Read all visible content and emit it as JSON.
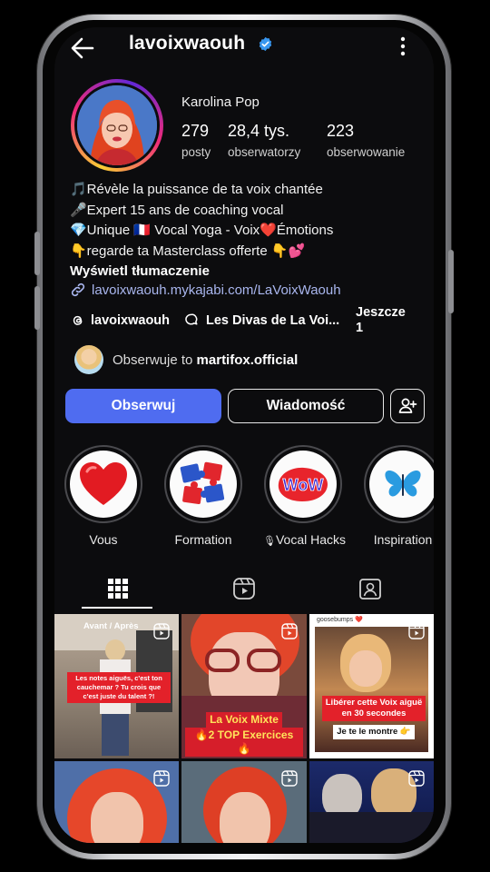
{
  "profile": {
    "username": "lavoixwaouh",
    "display_name": "Karolina Pop",
    "stats": [
      {
        "value": "279",
        "label": "posty"
      },
      {
        "value": "28,4 tys.",
        "label": "obserwatorzy"
      },
      {
        "value": "223",
        "label": "obserwowanie"
      }
    ],
    "bio": [
      "🎵Révèle la puissance de ta voix chantée",
      "🎤Expert 15 ans de coaching vocal",
      "💎Unique 🇫🇷 Vocal Yoga - Voix❤️Émotions",
      "👇regarde ta Masterclass offerte 👇💕"
    ],
    "translate_label": "Wyświetl tłumaczenie",
    "link": "lavoixwaouh.mykajabi.com/LaVoixWaouh",
    "threads_handle": "lavoixwaouh",
    "community_name": "Les Divas de La Voi...",
    "more_label": "Jeszcze",
    "more_count": "1",
    "followed_by_prefix": "Obserwuje to",
    "followed_by_user": "martifox.official"
  },
  "actions": {
    "follow": "Obserwuj",
    "message": "Wiadomość"
  },
  "highlights": [
    {
      "label": "Vous",
      "icon": "heart-icon"
    },
    {
      "label": "Formation",
      "icon": "puzzle-icon"
    },
    {
      "label": "Vocal Hacks",
      "icon": "wow-sticker-icon",
      "prefix_emoji": "🎙"
    },
    {
      "label": "Inspiration",
      "icon": "butterfly-icon"
    }
  ],
  "tabs": [
    "grid-icon",
    "reels-icon",
    "tagged-icon"
  ],
  "posts": [
    {
      "top_label": "Avant / Après",
      "caption": "Les notes aiguës, c'est ton cauchemar ? Tu crois que c'est juste du talent ?!"
    },
    {
      "caption_line1": "La Voix Mixte",
      "caption_line2": "🔥2 TOP Exercices 🔥"
    },
    {
      "top_label": "goosebumps ❤️",
      "caption_line1": "Libérer cette Voix aiguë en 30 secondes",
      "caption_line2": "Je te le montre 👉"
    },
    {},
    {},
    {}
  ],
  "colors": {
    "background": "#0c0c0e",
    "follow_button": "#4f6cf0",
    "link": "#a9b6ee",
    "verified": "#3897f0"
  }
}
